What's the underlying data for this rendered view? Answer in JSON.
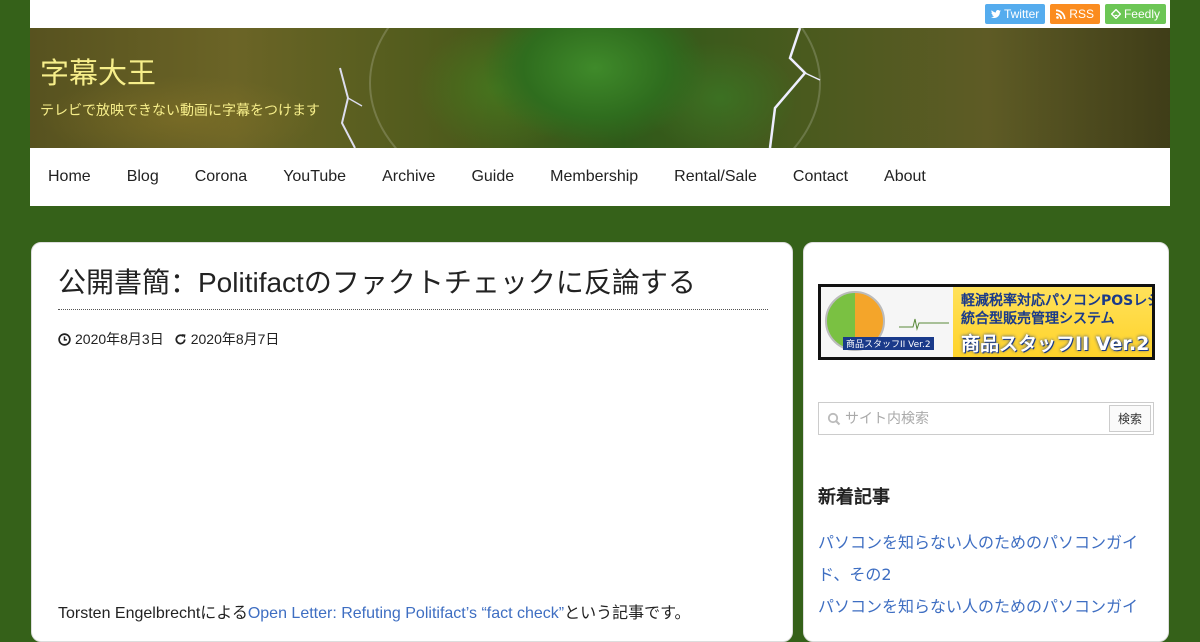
{
  "social": {
    "twitter": "Twitter",
    "rss": "RSS",
    "feedly": "Feedly"
  },
  "site": {
    "title": "字幕大王",
    "description": "テレビで放映できない動画に字幕をつけます"
  },
  "nav": [
    "Home",
    "Blog",
    "Corona",
    "YouTube",
    "Archive",
    "Guide",
    "Membership",
    "Rental/Sale",
    "Contact",
    "About"
  ],
  "article": {
    "title": "公開書簡：Politifactのファクトチェックに反論する",
    "published": "2020年8月3日",
    "updated": "2020年8月7日",
    "intro_prefix": "Torsten Engelbrechtによる",
    "intro_link": "Open Letter: Refuting Politifact’s “fact check”",
    "intro_suffix": "という記事です。"
  },
  "sidebar": {
    "banner": {
      "line1": "軽減税率対応パソコンPOSレジ",
      "line2": "統合型販売管理システム",
      "product": "商品スタッフII Ver.2",
      "badge": "商品スタッフII Ver.2"
    },
    "search": {
      "placeholder": "サイト内検索",
      "button": "検索"
    },
    "recent_title": "新着記事",
    "recent": [
      "パソコンを知らない人のためのパソコンガイド、その2",
      "パソコンを知らない人のためのパソコンガイ"
    ]
  },
  "colors": {
    "background": "#356119",
    "title": "#f6ee8a",
    "link": "#3e6ec2",
    "twitter": "#55acee",
    "rss": "#fb8c1f",
    "feedly": "#6cc655"
  }
}
